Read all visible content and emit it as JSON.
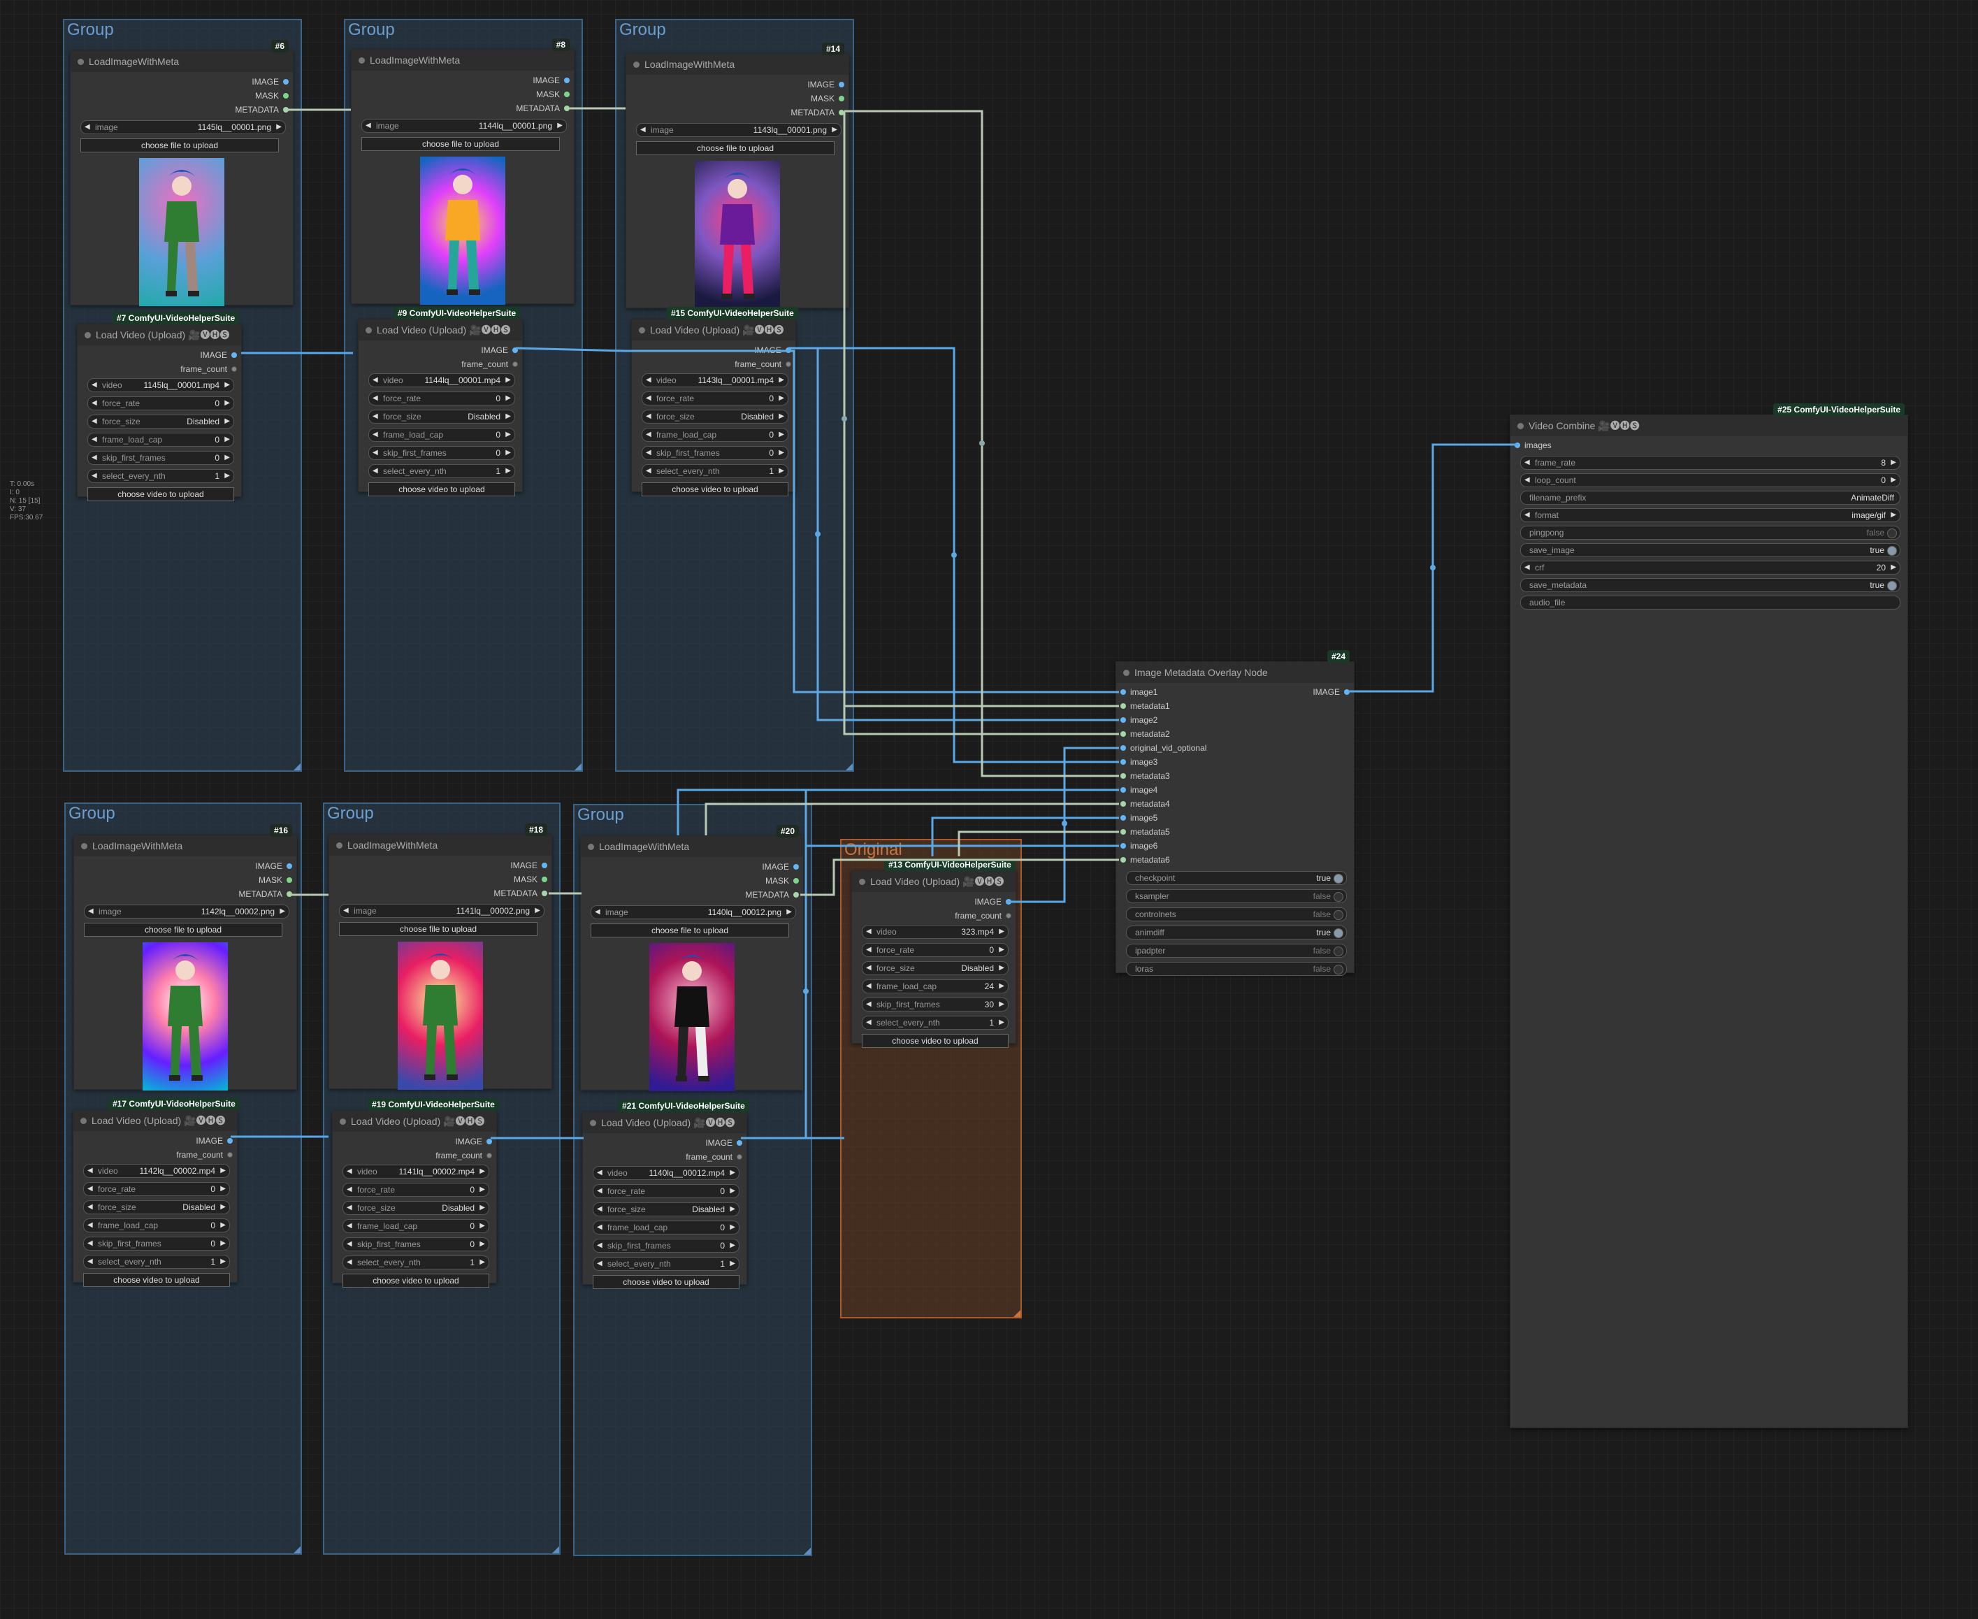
{
  "stats": [
    "T: 0.00s",
    "I: 0",
    "N: 15 [15]",
    "V: 37",
    "FPS:30.67"
  ],
  "groups": [
    {
      "title": "Group"
    },
    {
      "title": "Group"
    },
    {
      "title": "Group"
    },
    {
      "title": "Group"
    },
    {
      "title": "Group"
    },
    {
      "title": "Group"
    },
    {
      "title": "Original"
    }
  ],
  "lim_nodes": [
    {
      "badge": "#6",
      "title": "LoadImageWithMeta",
      "image": "1145lq__00001.png"
    },
    {
      "badge": "#8",
      "title": "LoadImageWithMeta",
      "image": "1144lq__00001.png"
    },
    {
      "badge": "#14",
      "title": "LoadImageWithMeta",
      "image": "1143lq__00001.png"
    },
    {
      "badge": "#16",
      "title": "LoadImageWithMeta",
      "image": "1142lq__00002.png"
    },
    {
      "badge": "#18",
      "title": "LoadImageWithMeta",
      "image": "1141lq__00002.png"
    },
    {
      "badge": "#20",
      "title": "LoadImageWithMeta",
      "image": "1140lq__00012.png"
    }
  ],
  "lim_outputs": [
    "IMAGE",
    "MASK",
    "METADATA"
  ],
  "lim_widget_label": "image",
  "upload_file_label": "choose file to upload",
  "lv_nodes": [
    {
      "badge": "#7 ComfyUI-VideoHelperSuite",
      "video": "1145lq__00001.mp4",
      "force_rate": "0",
      "force_size": "Disabled",
      "frame_load_cap": "0",
      "skip_first_frames": "0",
      "select_every_nth": "1"
    },
    {
      "badge": "#9 ComfyUI-VideoHelperSuite",
      "video": "1144lq__00001.mp4",
      "force_rate": "0",
      "force_size": "Disabled",
      "frame_load_cap": "0",
      "skip_first_frames": "0",
      "select_every_nth": "1"
    },
    {
      "badge": "#15 ComfyUI-VideoHelperSuite",
      "video": "1143lq__00001.mp4",
      "force_rate": "0",
      "force_size": "Disabled",
      "frame_load_cap": "0",
      "skip_first_frames": "0",
      "select_every_nth": "1"
    },
    {
      "badge": "#17 ComfyUI-VideoHelperSuite",
      "video": "1142lq__00002.mp4",
      "force_rate": "0",
      "force_size": "Disabled",
      "frame_load_cap": "0",
      "skip_first_frames": "0",
      "select_every_nth": "1"
    },
    {
      "badge": "#19 ComfyUI-VideoHelperSuite",
      "video": "1141lq__00002.mp4",
      "force_rate": "0",
      "force_size": "Disabled",
      "frame_load_cap": "0",
      "skip_first_frames": "0",
      "select_every_nth": "1"
    },
    {
      "badge": "#21 ComfyUI-VideoHelperSuite",
      "video": "1140lq__00012.mp4",
      "force_rate": "0",
      "force_size": "Disabled",
      "frame_load_cap": "0",
      "skip_first_frames": "0",
      "select_every_nth": "1"
    },
    {
      "badge": "#13 ComfyUI-VideoHelperSuite",
      "video": "323.mp4",
      "force_rate": "0",
      "force_size": "Disabled",
      "frame_load_cap": "24",
      "skip_first_frames": "30",
      "select_every_nth": "1"
    }
  ],
  "lv_title": "Load Video (Upload) 🎥🅥🅗🅢",
  "lv_outputs": [
    "IMAGE",
    "frame_count"
  ],
  "lv_labels": {
    "video": "video",
    "force_rate": "force_rate",
    "force_size": "force_size",
    "frame_load_cap": "frame_load_cap",
    "skip_first_frames": "skip_first_frames",
    "select_every_nth": "select_every_nth"
  },
  "upload_video_label": "choose video to upload",
  "overlay": {
    "badge": "#24",
    "title": "Image Metadata Overlay Node",
    "output": "IMAGE",
    "inputs": [
      "image1",
      "metadata1",
      "image2",
      "metadata2",
      "original_vid_optional",
      "image3",
      "metadata3",
      "image4",
      "metadata4",
      "image5",
      "metadata5",
      "image6",
      "metadata6"
    ],
    "toggles": [
      {
        "label": "checkpoint",
        "value": "true"
      },
      {
        "label": "ksampler",
        "value": "false"
      },
      {
        "label": "controlnets",
        "value": "false"
      },
      {
        "label": "animdiff",
        "value": "true"
      },
      {
        "label": "ipadpter",
        "value": "false"
      },
      {
        "label": "loras",
        "value": "false"
      }
    ]
  },
  "combine": {
    "badge": "#25 ComfyUI-VideoHelperSuite",
    "title": "Video Combine 🎥🅥🅗🅢",
    "input": "images",
    "frame_rate_label": "frame_rate",
    "frame_rate": "8",
    "loop_count_label": "loop_count",
    "loop_count": "0",
    "filename_prefix_label": "filename_prefix",
    "filename_prefix": "AnimateDiff",
    "format_label": "format",
    "format": "image/gif",
    "pingpong_label": "pingpong",
    "pingpong": "false",
    "save_image_label": "save_image",
    "save_image": "true",
    "crf_label": "crf",
    "crf": "20",
    "save_metadata_label": "save_metadata",
    "save_metadata": "true",
    "audio_file_label": "audio_file"
  },
  "colors": {
    "image_wire": "#5aa9e6",
    "metadata_wire": "#b7c9b3",
    "group_blue": "#3b6385",
    "group_orange": "#a85b2e"
  }
}
